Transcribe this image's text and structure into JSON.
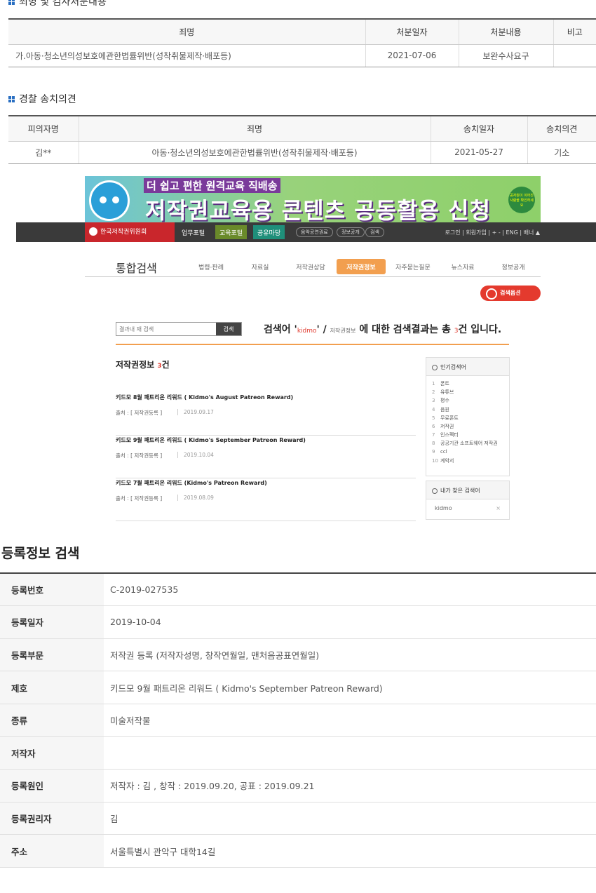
{
  "section1": {
    "title": "죄명 및 검사처분내용",
    "headers": [
      "죄명",
      "처분일자",
      "처분내용",
      "비고"
    ],
    "row": [
      "가.아동·청소년의성보호에관한법률위반(성착취물제작·배포등)",
      "2021-07-06",
      "보완수사요구",
      ""
    ]
  },
  "section2": {
    "title": "경찰 송치의견",
    "headers": [
      "피의자명",
      "죄명",
      "송치일자",
      "송치의견"
    ],
    "row": [
      "김**",
      "아동·청소년의성보호에관한법률위반(성착취물제작·배포등)",
      "2021-05-27",
      "기소"
    ]
  },
  "screenshot": {
    "banner": {
      "sub": "더 쉽고 편한 원격교육 직배송",
      "main": "저작권교육용 콘텐츠 공동활용 신청",
      "badge": "공자원이 이어진 사람을 확인하세요"
    },
    "nav": {
      "logo": "한국저작권위원회",
      "buttons": [
        "업무포털",
        "교육포털",
        "공유마당"
      ],
      "pills": [
        "음악공연권료",
        "정보공개",
        "검색"
      ],
      "right": "로그인 | 회원가입 | + - | ENG | 배너 ▲"
    },
    "tabs": {
      "title": "통합검색",
      "items": [
        "법령·판례",
        "자료실",
        "저작권상담",
        "저작권정보",
        "자주묻는질문",
        "뉴스자료",
        "정보공개"
      ],
      "active_index": 3
    },
    "search_option": "검색옵션",
    "search_input_placeholder": "결과내 재 검색",
    "search_button": "검색",
    "result": {
      "prefix": "검색어 '",
      "keyword": "kidmo",
      "mid": "' / ",
      "category": "저작권정보",
      "suffix1": " 에 대한 검색결과는 총 ",
      "count": "3",
      "suffix2": "건 입니다."
    },
    "list_title": "저작권정보",
    "list_count": "3",
    "list_unit": "건",
    "items": [
      {
        "name": "키드모 8월 패트리온 리워드 ( Kidmo's August Patreon Reward)",
        "source": "출처 : [ 저작권등록 ]",
        "date": "2019.09.17"
      },
      {
        "name": "키드모 9월 패트리온 리워드 ( Kidmo's September Patreon Reward)",
        "source": "출처 : [ 저작권등록 ]",
        "date": "2019.10.04"
      },
      {
        "name": "키드모 7월 패트리온 리워드 (Kidmo's Patreon Reward)",
        "source": "출처 : [ 저작권등록 ]",
        "date": "2019.08.09"
      }
    ],
    "popular": {
      "title": "인기검색어",
      "items": [
        "폰트",
        "유튜브",
        "평수",
        "음원",
        "무료폰트",
        "저작권",
        "인스펙터",
        "공공기관 소프트웨어 저작권",
        "ccl",
        "계약서"
      ]
    },
    "recent": {
      "title": "내가 찾은 검색어",
      "keyword": "kidmo",
      "remove": "×"
    }
  },
  "registration": {
    "title": "등록정보 검색",
    "rows": [
      {
        "label": "등록번호",
        "value": "C-2019-027535"
      },
      {
        "label": "등록일자",
        "value": "2019-10-04"
      },
      {
        "label": "등록부문",
        "value": "저작권 등록 (저작자성명, 창작연월일, 맨처음공표연월일)"
      },
      {
        "label": "제호",
        "value": "키드모 9월 패트리온 리워드 ( Kidmo's September Patreon Reward)"
      },
      {
        "label": "종류",
        "value": "미술저작물"
      },
      {
        "label": "저작자",
        "value": ""
      },
      {
        "label": "등록원인",
        "value": "저작자 : 김 , 창작 : 2019.09.20, 공표 : 2019.09.21"
      },
      {
        "label": "등록권리자",
        "value": "김"
      },
      {
        "label": "주소",
        "value": "서울특별시 관악구 대학14길"
      }
    ]
  }
}
